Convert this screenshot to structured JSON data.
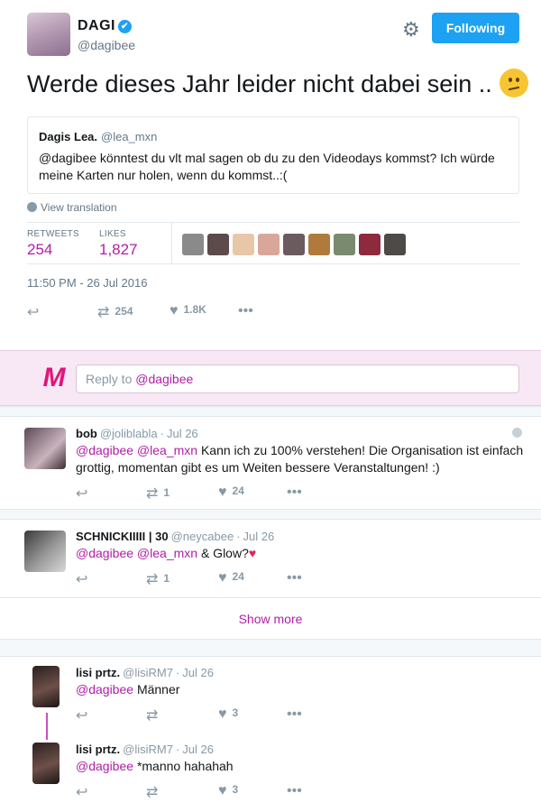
{
  "tweet": {
    "author_name": "DAGI",
    "author_handle": "@dagibee",
    "verified_mark": "✔",
    "settings_icon": "gear-icon",
    "follow_label": "Following",
    "text": "Werde dieses Jahr leider nicht dabei sein ..",
    "quoted": {
      "name": "Dagis Lea.",
      "handle": "@lea_mxn",
      "text": "@dagibee könntest du vlt mal sagen ob du zu den Videodays kommst? Ich würde meine Karten nur holen, wenn du kommst..:("
    },
    "view_translation": "View translation",
    "retweets_label": "RETWEETS",
    "retweets_value": "254",
    "likes_label": "LIKES",
    "likes_value": "1,827",
    "timestamp": "11:50 PM - 26 Jul 2016",
    "action_retweet_count": "254",
    "action_like_count": "1.8K"
  },
  "reply_box": {
    "logo": "M",
    "placeholder_prefix": "Reply to ",
    "placeholder_mention": "@dagibee"
  },
  "replies": [
    {
      "name": "bob",
      "handle": "@joliblabla",
      "date": "Jul 26",
      "mentions": "@dagibee @lea_mxn",
      "text": "Kann ich zu 100% verstehen! Die Organisation ist einfach grottig, momentan gibt es um Weiten bessere Veranstaltungen! :)",
      "retweets": "1",
      "likes": "24"
    },
    {
      "name": "SCHNICKIIIII | 30",
      "handle": "@neycabee",
      "date": "Jul 26",
      "mentions": "@dagibee @lea_mxn",
      "text": "& Glow?",
      "emoji": "♥",
      "retweets": "1",
      "likes": "24"
    }
  ],
  "show_more": "Show more",
  "thread": [
    {
      "name": "lisi prtz.",
      "handle": "@lisiRM7",
      "date": "Jul 26",
      "mentions": "@dagibee",
      "text": "Männer",
      "retweets": "",
      "likes": "3"
    },
    {
      "name": "lisi prtz.",
      "handle": "@lisiRM7",
      "date": "Jul 26",
      "mentions": "@dagibee",
      "text": "*manno hahahah",
      "retweets": "",
      "likes": "3"
    }
  ],
  "colors": {
    "accent": "#b01ea8",
    "follow_button": "#1da1f2",
    "reply_band": "#f8e8f5",
    "logo": "#e0157a"
  }
}
